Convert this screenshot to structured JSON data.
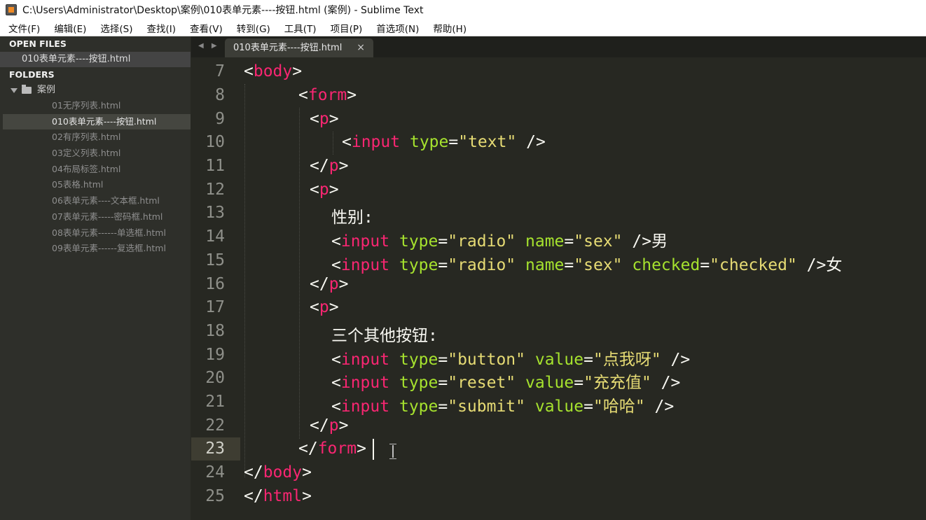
{
  "window": {
    "title": "C:\\Users\\Administrator\\Desktop\\案例\\010表单元素----按钮.html (案例) - Sublime Text"
  },
  "menu": [
    "文件(F)",
    "编辑(E)",
    "选择(S)",
    "查找(I)",
    "查看(V)",
    "转到(G)",
    "工具(T)",
    "项目(P)",
    "首选项(N)",
    "帮助(H)"
  ],
  "sidebar": {
    "open_files_label": "OPEN FILES",
    "open_file": "010表单元素----按钮.html",
    "folders_label": "FOLDERS",
    "folder_name": "案例",
    "files": [
      "01无序列表.html",
      "010表单元素----按钮.html",
      "02有序列表.html",
      "03定义列表.html",
      "04布局标签.html",
      "05表格.html",
      "06表单元素----文本框.html",
      "07表单元素-----密码框.html",
      "08表单元素------单选框.html",
      "09表单元素------复选框.html"
    ],
    "active_file_index": 1
  },
  "tabs": {
    "nav_arrows": "◀ ▶",
    "active_tab": "010表单元素----按钮.html",
    "close_glyph": "×"
  },
  "editor": {
    "line_numbers": [
      "7",
      "8",
      "9",
      "10",
      "11",
      "12",
      "13",
      "14",
      "15",
      "16",
      "17",
      "18",
      "19",
      "20",
      "21",
      "22",
      "23",
      "24",
      "25"
    ],
    "current_line": "23",
    "code": {
      "body_open": "body",
      "form_open": "form",
      "p": "p",
      "input": "input",
      "type_attr": "type",
      "name_attr": "name",
      "checked_attr": "checked",
      "value_attr": "value",
      "text_val": "\"text\"",
      "radio_val": "\"radio\"",
      "sex_val": "\"sex\"",
      "checked_val": "\"checked\"",
      "button_val": "\"button\"",
      "reset_val": "\"reset\"",
      "submit_val": "\"submit\"",
      "val_1": "\"点我呀\"",
      "val_2": "\"充充值\"",
      "val_3": "\"哈哈\"",
      "gender_label": "性别:",
      "male": "男",
      "female": "女",
      "buttons_label": "三个其他按钮:",
      "html": "html"
    }
  }
}
